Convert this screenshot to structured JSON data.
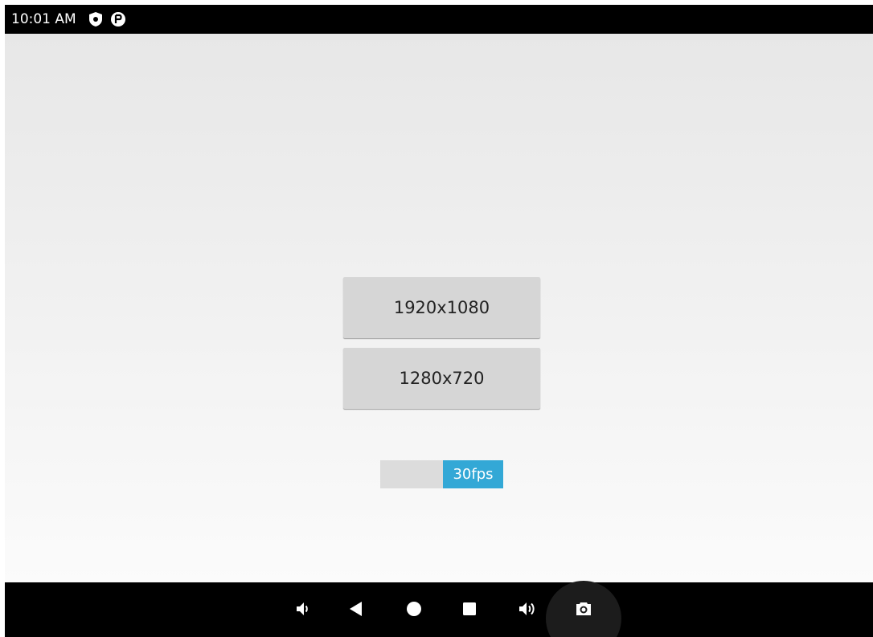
{
  "status_bar": {
    "time": "10:01 AM",
    "icons": [
      "shield-icon",
      "data-saver-icon"
    ]
  },
  "main": {
    "resolution_buttons": [
      {
        "label": "1920x1080"
      },
      {
        "label": "1280x720"
      }
    ],
    "fps_toggle": {
      "label": "30fps",
      "state": "on",
      "accent_color": "#33a8d6"
    }
  },
  "nav_bar": {
    "buttons": [
      "volume-down-icon",
      "back-icon",
      "home-icon",
      "recents-icon",
      "volume-up-icon",
      "screenshot-icon"
    ]
  },
  "colors": {
    "status_bar_bg": "#000000",
    "button_bg": "#d6d6d6",
    "toggle_accent": "#33a8d6"
  }
}
